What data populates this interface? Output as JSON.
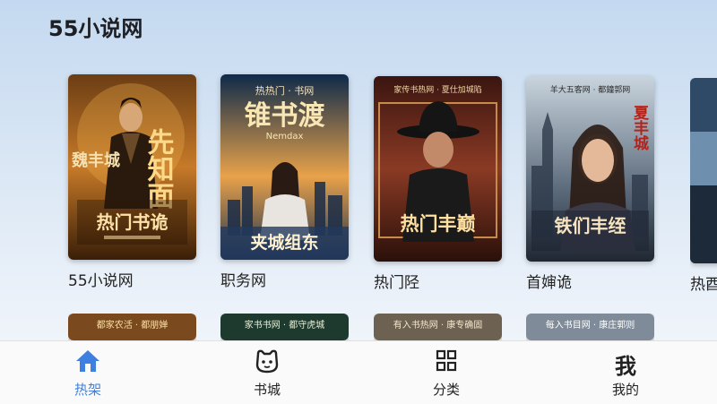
{
  "header": {
    "title": "55小说网"
  },
  "books": [
    {
      "label": "55小说网",
      "cover": {
        "top": "",
        "title": "先知面",
        "side": "魏丰城",
        "bottom": "热门书诡"
      }
    },
    {
      "label": "职务网",
      "cover": {
        "top": "热热门 · 书网",
        "title": "锥书渡",
        "sub": "Nemdax",
        "bottom": "夹城组东"
      }
    },
    {
      "label": "热门陉",
      "cover": {
        "top": "家传书热网 · 夏仕加城陷",
        "bottom": "热门丰巅"
      }
    },
    {
      "label": "首婶诡",
      "cover": {
        "top": "羊大五客网 · 都鐘郭网",
        "title": "夏丰城",
        "bottom": "铁们丰绖"
      }
    },
    {
      "label": "热酉",
      "cover": {}
    }
  ],
  "row2_covers": [
    {
      "top": "都家农活 · 都朋婵"
    },
    {
      "top": "家书书网 · 都守虎城"
    },
    {
      "top": "有入书热网 · 康专确固"
    },
    {
      "top": "每入书目网 · 康庄郭则"
    }
  ],
  "tabbar": {
    "tabs": [
      {
        "label": "热架",
        "icon": "home-icon",
        "active": true
      },
      {
        "label": "书城",
        "icon": "face-icon"
      },
      {
        "label": "分类",
        "icon": "grid-icon"
      },
      {
        "label": "我的",
        "icon": "wo-icon",
        "glyph": "我"
      }
    ],
    "accent": "#3f7fe0"
  }
}
